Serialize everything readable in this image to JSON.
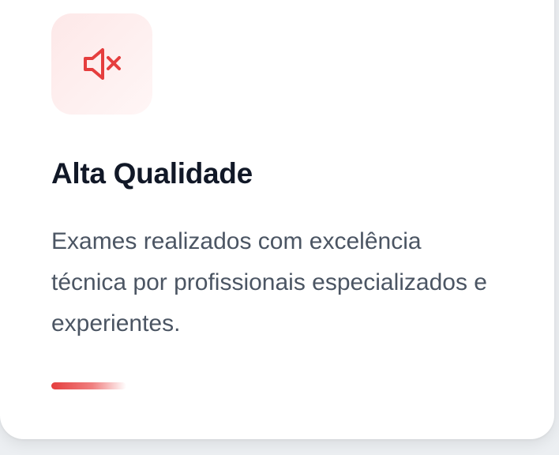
{
  "card": {
    "icon": "speaker-muted-icon",
    "title": "Alta Qualidade",
    "description": "Exames realizados com excelência técnica por profissionais especializados e experientes."
  },
  "colors": {
    "accent": "#e53e3e",
    "title": "#111827",
    "text": "#4b5563",
    "icon_bg": "#fdecec"
  }
}
